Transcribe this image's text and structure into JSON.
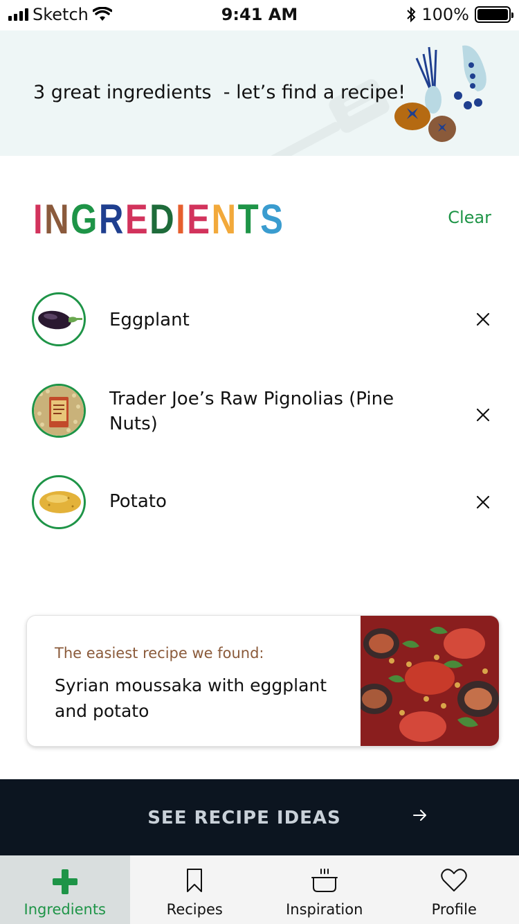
{
  "status_bar": {
    "carrier": "Sketch",
    "time": "9:41 AM",
    "battery": "100%",
    "icons": [
      "signal-icon",
      "wifi-icon",
      "bluetooth-icon",
      "battery-icon"
    ]
  },
  "banner": {
    "text": "3 great ingredients  - let’s find a recipe!",
    "illustration": "vegetables-and-spatula"
  },
  "ingredients_section": {
    "title_letters": [
      {
        "ch": "I",
        "color": "#d2335c"
      },
      {
        "ch": "N",
        "color": "#8b5a3c"
      },
      {
        "ch": "G",
        "color": "#1e9447"
      },
      {
        "ch": "R",
        "color": "#1f3f8f"
      },
      {
        "ch": "E",
        "color": "#d2335c"
      },
      {
        "ch": "D",
        "color": "#1e6b3a"
      },
      {
        "ch": "I",
        "color": "#e65f2e"
      },
      {
        "ch": "E",
        "color": "#d2335c"
      },
      {
        "ch": "N",
        "color": "#f2a93b"
      },
      {
        "ch": "T",
        "color": "#1e9447"
      },
      {
        "ch": "S",
        "color": "#3a9ccf"
      }
    ],
    "clear_label": "Clear",
    "items": [
      {
        "name": "Eggplant",
        "icon": "eggplant-image"
      },
      {
        "name": "Trader Joe’s Raw Pignolias (Pine Nuts)",
        "icon": "pine-nuts-package-image"
      },
      {
        "name": "Potato",
        "icon": "potato-image"
      }
    ]
  },
  "recipe_card": {
    "eyebrow": "The easiest recipe we found:",
    "title": "Syrian moussaka with eggplant and potato",
    "photo": "moussaka-photo"
  },
  "cta": {
    "label": "SEE RECIPE IDEAS",
    "icon": "arrow-right-icon"
  },
  "tab_bar": {
    "active": "Ingredients",
    "tabs": [
      {
        "label": "Ingredients",
        "icon": "plus-icon"
      },
      {
        "label": "Recipes",
        "icon": "bookmark-icon"
      },
      {
        "label": "Inspiration",
        "icon": "pot-icon"
      },
      {
        "label": "Profile",
        "icon": "heart-icon"
      }
    ]
  },
  "colors": {
    "accent_green": "#1e9447",
    "banner_bg": "#eef6f6",
    "cta_bg": "#0c1520",
    "eyebrow_brown": "#8a5a3a"
  }
}
